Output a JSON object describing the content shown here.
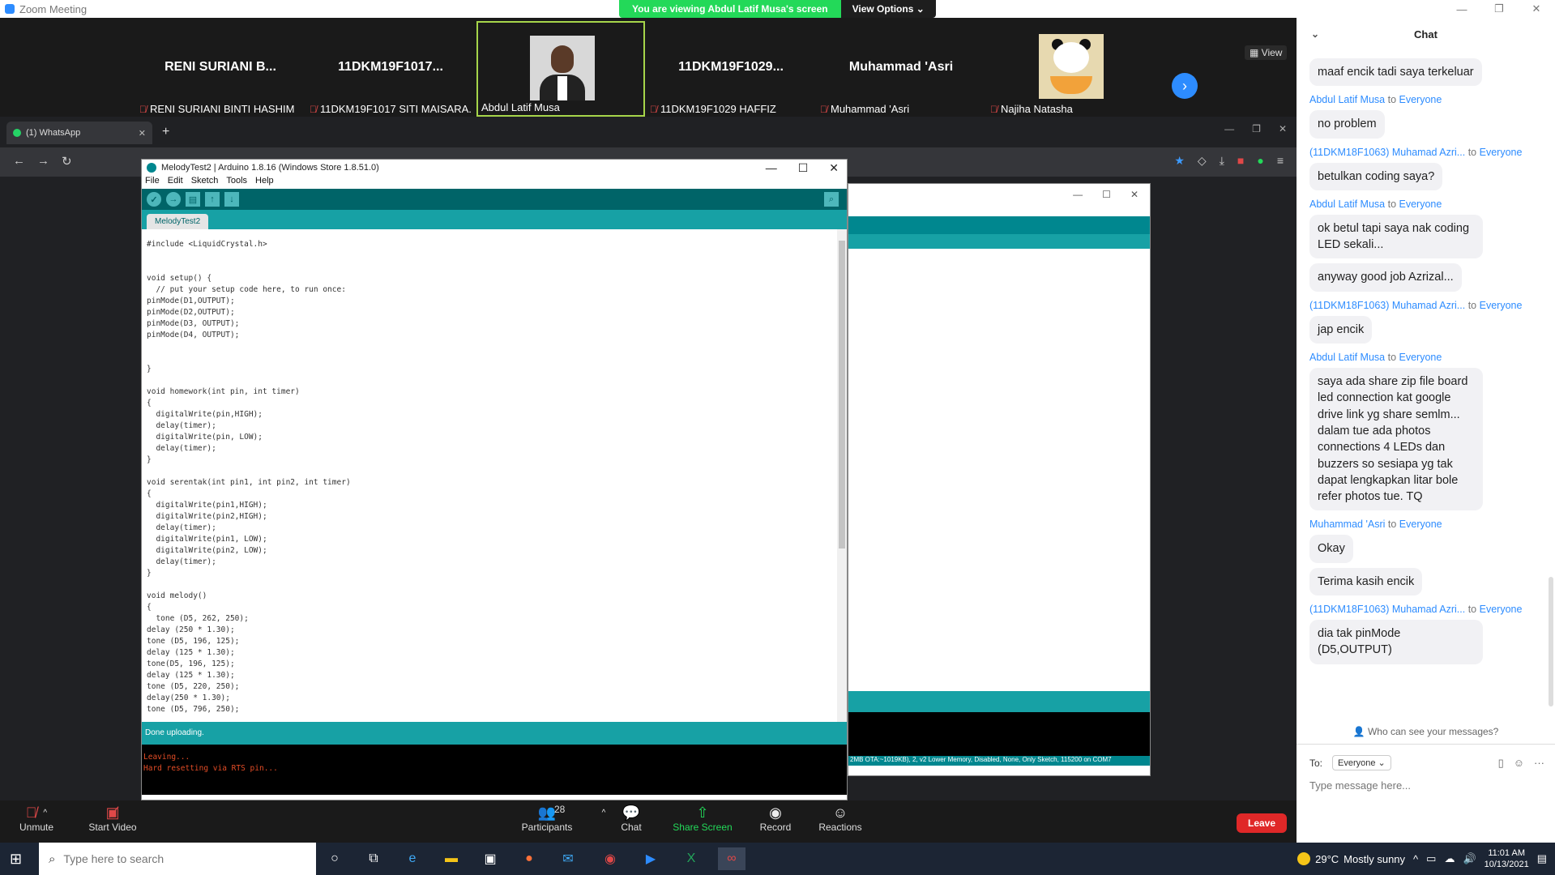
{
  "window": {
    "title": "Zoom Meeting",
    "controls": [
      "—",
      "❐",
      "✕"
    ]
  },
  "banner": {
    "message": "You are viewing Abdul Latif Musa's screen",
    "options": "View Options ⌄"
  },
  "gallery": {
    "view_label": "▦ View",
    "tiles": [
      {
        "big": "RENI SURIANI B...",
        "foot": "RENI SURIANI BINTI HASHIM"
      },
      {
        "big": "11DKM19F1017...",
        "foot": "11DKM19F1017 SITI MAISARA..."
      },
      {
        "big": "",
        "foot": "Abdul Latif Musa"
      },
      {
        "big": "11DKM19F1029...",
        "foot": "11DKM19F1029 HAFFIZ"
      },
      {
        "big": "Muhammad 'Asri",
        "foot": "Muhammad 'Asri"
      },
      {
        "big": "",
        "foot": "Najiha Natasha"
      }
    ]
  },
  "browser": {
    "tab_label": "(1) WhatsApp",
    "tab_close": "✕",
    "new_tab": "+"
  },
  "arduino": {
    "title": "MelodyTest2 | Arduino 1.8.16 (Windows Store 1.8.51.0)",
    "menu": [
      "File",
      "Edit",
      "Sketch",
      "Tools",
      "Help"
    ],
    "tab": "MelodyTest2",
    "code": [
      "#include <LiquidCrystal.h>",
      "",
      "",
      "void setup() {",
      "  // put your setup code here, to run once:",
      "pinMode(D1,OUTPUT);",
      "pinMode(D2,OUTPUT);",
      "pinMode(D3, OUTPUT);",
      "pinMode(D4, OUTPUT);",
      "",
      "",
      "}",
      "",
      "void homework(int pin, int timer)",
      "{",
      "  digitalWrite(pin,HIGH);",
      "  delay(timer);",
      "  digitalWrite(pin, LOW);",
      "  delay(timer);",
      "}",
      "",
      "void serentak(int pin1, int pin2, int timer)",
      "{",
      "  digitalWrite(pin1,HIGH);",
      "  digitalWrite(pin2,HIGH);",
      "  delay(timer);",
      "  digitalWrite(pin1, LOW);",
      "  digitalWrite(pin2, LOW);",
      "  delay(timer);",
      "}",
      "",
      "void melody()",
      "{",
      "  tone (D5, 262, 250);",
      "delay (250 * 1.30);",
      "tone (D5, 196, 125);",
      "delay (125 * 1.30);",
      "tone(D5, 196, 125);",
      "delay (125 * 1.30);",
      "tone (D5, 220, 250);",
      "delay(250 * 1.30);",
      "tone (D5, 796, 250);"
    ],
    "status": "Done uploading.",
    "console": [
      "Leaving...",
      "Hard resetting via RTS pin..."
    ],
    "board_info": "2MB OTA:~1019KB), 2, v2 Lower Memory, Disabled, None, Only Sketch, 115200 on COM7"
  },
  "controls": {
    "unmute": "Unmute",
    "start_video": "Start Video",
    "participants": "Participants",
    "participants_count": "28",
    "chat": "Chat",
    "share_screen": "Share Screen",
    "record": "Record",
    "reactions": "Reactions",
    "leave": "Leave"
  },
  "chat": {
    "title": "Chat",
    "messages": [
      {
        "sender": "",
        "to": "",
        "recipient": "",
        "lines": [
          "maaf encik tadi saya terkeluar"
        ]
      },
      {
        "sender": "Abdul Latif Musa",
        "to": "to",
        "recipient": "Everyone",
        "lines": [
          "no problem"
        ]
      },
      {
        "sender": "(11DKM18F1063) Muhamad Azri...",
        "to": "to",
        "recipient": "Everyone",
        "lines": [
          "betulkan coding saya?"
        ]
      },
      {
        "sender": "Abdul Latif Musa",
        "to": "to",
        "recipient": "Everyone",
        "lines": [
          "ok betul tapi saya nak coding LED sekali...",
          "anyway good job Azrizal..."
        ]
      },
      {
        "sender": "(11DKM18F1063) Muhamad Azri...",
        "to": "to",
        "recipient": "Everyone",
        "lines": [
          "jap encik"
        ]
      },
      {
        "sender": "Abdul Latif Musa",
        "to": "to",
        "recipient": "Everyone",
        "lines": [
          "saya ada share zip file board led connection kat google drive link yg share semlm... dalam tue ada photos connections 4 LEDs dan buzzers so sesiapa yg tak dapat lengkapkan litar bole refer photos tue. TQ"
        ]
      },
      {
        "sender": "Muhammad 'Asri",
        "to": "to",
        "recipient": "Everyone",
        "lines": [
          "Okay",
          "Terima kasih encik"
        ]
      },
      {
        "sender": "(11DKM18F1063) Muhamad Azri...",
        "to": "to",
        "recipient": "Everyone",
        "lines": [
          "dia tak pinMode (D5,OUTPUT)"
        ]
      }
    ],
    "privacy": "Who can see your messages?",
    "to_label": "To:",
    "to_value": "Everyone ⌄",
    "placeholder": "Type message here..."
  },
  "taskbar": {
    "search_placeholder": "Type here to search",
    "temperature": "29°C",
    "weather": "Mostly sunny",
    "time": "11:01 AM",
    "date": "10/13/2021"
  }
}
